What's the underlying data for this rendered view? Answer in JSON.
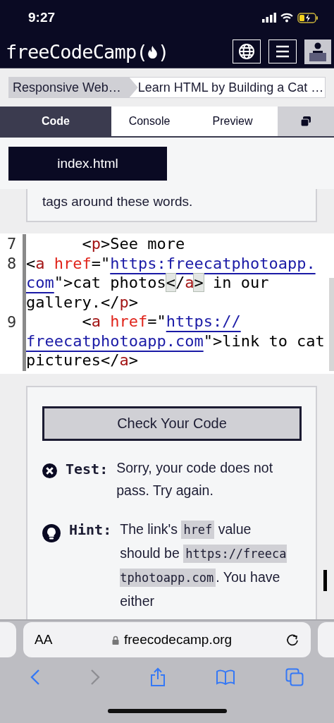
{
  "status_bar": {
    "time": "9:27"
  },
  "header": {
    "logo": "freeCodeCamp",
    "logo_open": "(",
    "logo_close": ")"
  },
  "breadcrumbs": [
    {
      "label": "Responsive Web…"
    },
    {
      "label": "Learn HTML by Building a Cat …"
    }
  ],
  "tabs": [
    {
      "label": "Code",
      "selected": true
    },
    {
      "label": "Console",
      "selected": false
    },
    {
      "label": "Preview",
      "selected": false
    }
  ],
  "file_tab": {
    "label": "index.html"
  },
  "instructions": {
    "text": "tags around these words."
  },
  "editor": {
    "lines": [
      {
        "number": "7",
        "tokens": [
          {
            "kind": "plain",
            "text": "      <"
          },
          {
            "kind": "tag",
            "text": "p"
          },
          {
            "kind": "plain",
            "text": ">See more"
          }
        ]
      },
      {
        "number": "8",
        "tokens": [
          {
            "kind": "plain",
            "text": "<"
          },
          {
            "kind": "tag",
            "text": "a "
          },
          {
            "kind": "attr",
            "text": "href"
          },
          {
            "kind": "plain",
            "text": "=\""
          },
          {
            "kind": "link",
            "text": "https:freecatphotoapp."
          },
          {
            "kind": "link",
            "text": "com"
          },
          {
            "kind": "plain",
            "text": "\">cat photos"
          },
          {
            "kind": "match",
            "text": "<"
          },
          {
            "kind": "plain",
            "text": "/"
          },
          {
            "kind": "tag",
            "text": "a"
          },
          {
            "kind": "match",
            "text": ">"
          },
          {
            "kind": "plain",
            "text": " in our gallery.</"
          },
          {
            "kind": "tag",
            "text": "p"
          },
          {
            "kind": "plain",
            "text": ">"
          }
        ]
      },
      {
        "number": "9",
        "tokens": [
          {
            "kind": "plain",
            "text": "      <"
          },
          {
            "kind": "tag",
            "text": "a "
          },
          {
            "kind": "attr",
            "text": "href"
          },
          {
            "kind": "plain",
            "text": "=\""
          },
          {
            "kind": "link",
            "text": "https://"
          },
          {
            "kind": "link",
            "text": "freecatphotoapp.com"
          },
          {
            "kind": "plain",
            "text": "\">link to cat pictures</"
          },
          {
            "kind": "tag",
            "text": "a"
          },
          {
            "kind": "plain",
            "text": ">"
          }
        ]
      }
    ]
  },
  "test_panel": {
    "button": "Check Your Code",
    "results": [
      {
        "kind": "test",
        "label": "Test:",
        "parts": [
          {
            "kind": "text",
            "text": "Sorry, your code does not pass. Try again."
          }
        ]
      },
      {
        "kind": "hint",
        "label": "Hint:",
        "parts": [
          {
            "kind": "text",
            "text": "The link's "
          },
          {
            "kind": "code",
            "text": "href"
          },
          {
            "kind": "text",
            "text": " value should be "
          },
          {
            "kind": "code",
            "text": "https://freecatphotoapp.com"
          },
          {
            "kind": "text",
            "text": ". You have either"
          }
        ]
      }
    ]
  },
  "browser": {
    "text_size": "AA",
    "address": "freecodecamp.org"
  }
}
